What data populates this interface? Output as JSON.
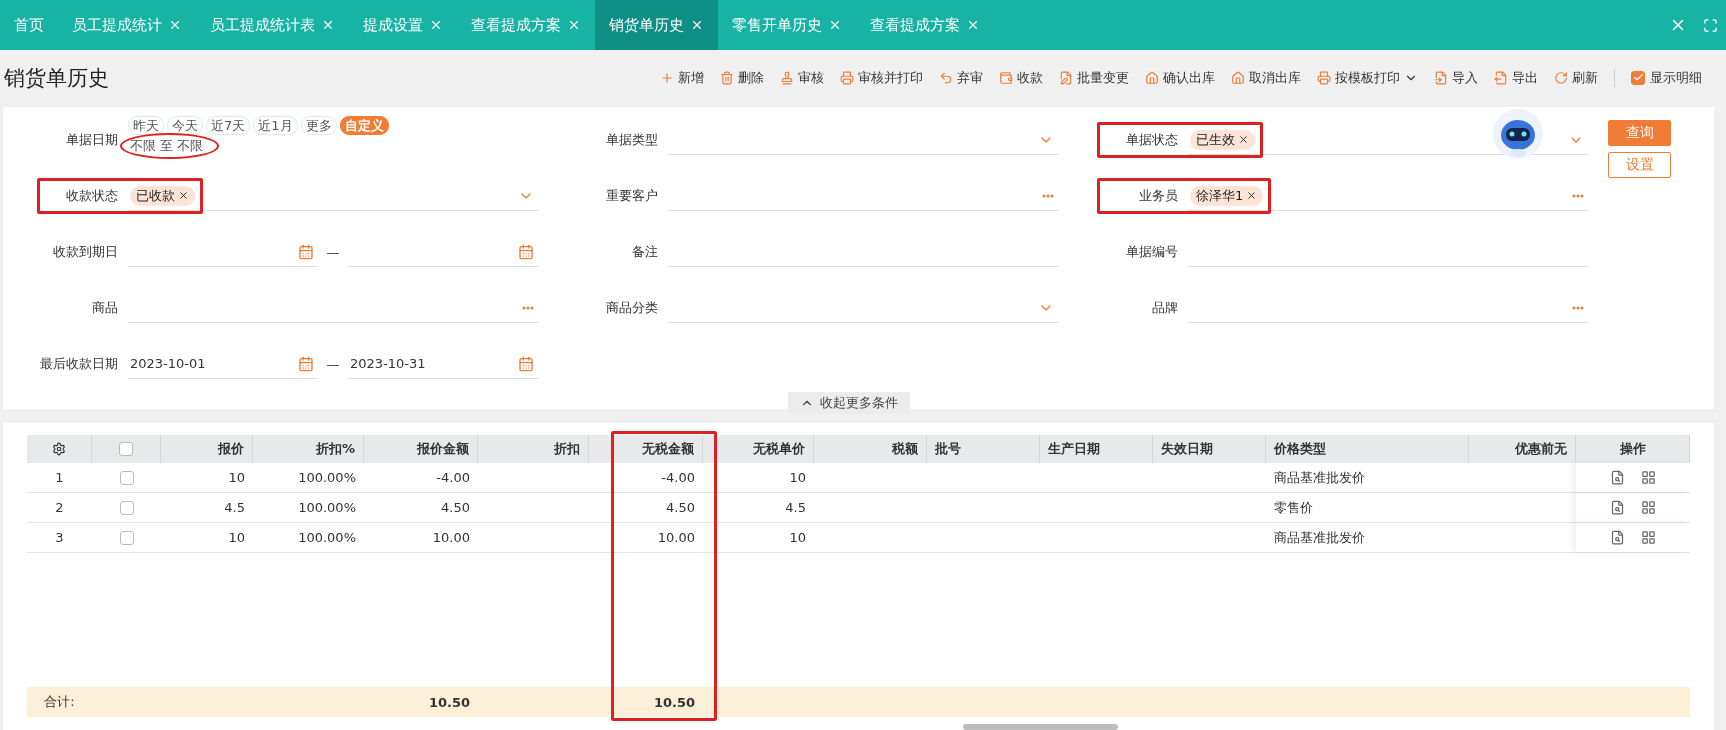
{
  "tabs": [
    {
      "label": "首页",
      "closable": false,
      "selected": false
    },
    {
      "label": "员工提成统计",
      "closable": true,
      "selected": false
    },
    {
      "label": "员工提成统计表",
      "closable": true,
      "selected": false
    },
    {
      "label": "提成设置",
      "closable": true,
      "selected": false
    },
    {
      "label": "查看提成方案",
      "closable": true,
      "selected": false
    },
    {
      "label": "销货单历史",
      "closable": true,
      "selected": true
    },
    {
      "label": "零售开单历史",
      "closable": true,
      "selected": false
    },
    {
      "label": "查看提成方案",
      "closable": true,
      "selected": false
    }
  ],
  "page_title": "销货单历史",
  "toolbar": {
    "actions": [
      {
        "label": "新增"
      },
      {
        "label": "删除"
      },
      {
        "label": "审核"
      },
      {
        "label": "审核并打印"
      },
      {
        "label": "弃审"
      },
      {
        "label": "收款"
      },
      {
        "label": "批量变更"
      },
      {
        "label": "确认出库"
      },
      {
        "label": "取消出库"
      },
      {
        "label": "按模板打印",
        "dropdown": true
      },
      {
        "label": "导入"
      },
      {
        "label": "导出"
      },
      {
        "label": "刷新"
      }
    ],
    "show_detail": {
      "label": "显示明细",
      "checked": true
    }
  },
  "filters": {
    "rows": [
      {
        "fields": [
          {
            "kind": "quick_dates",
            "label": "单据日期",
            "chips": [
              {
                "label": "昨天",
                "selected": false
              },
              {
                "label": "今天",
                "selected": false
              },
              {
                "label": "近7天",
                "selected": false
              },
              {
                "label": "近1月",
                "selected": false
              },
              {
                "label": "更多",
                "selected": false
              },
              {
                "label": "自定义",
                "selected": true
              }
            ],
            "range": {
              "text": "不限 至 不限",
              "circled": true
            }
          },
          {
            "kind": "select",
            "label": "单据类型"
          },
          {
            "kind": "select",
            "label": "单据状态",
            "tags": [
              "已生效"
            ],
            "boxed": true
          }
        ]
      },
      {
        "fields": [
          {
            "kind": "select",
            "label": "收款状态",
            "tags": [
              "已收款"
            ],
            "boxed": true
          },
          {
            "kind": "lookup",
            "label": "重要客户"
          },
          {
            "kind": "lookup",
            "label": "业务员",
            "tags": [
              "徐泽华1"
            ],
            "boxed": true
          }
        ]
      },
      {
        "fields": [
          {
            "kind": "daterange",
            "label": "收款到期日",
            "separator": "—"
          },
          {
            "kind": "text",
            "label": "备注"
          },
          {
            "kind": "text",
            "label": "单据编号"
          }
        ]
      },
      {
        "fields": [
          {
            "kind": "lookup",
            "label": "商品"
          },
          {
            "kind": "select",
            "label": "商品分类"
          },
          {
            "kind": "lookup",
            "label": "品牌"
          }
        ]
      },
      {
        "fields": [
          {
            "kind": "daterange",
            "label": "最后收款日期",
            "from": "2023-10-01",
            "to": "2023-10-31",
            "separator": "—"
          }
        ]
      }
    ],
    "buttons": [
      {
        "label": "查询",
        "kind": "primary"
      },
      {
        "label": "设置",
        "kind": "secondary"
      }
    ],
    "collapse": {
      "label": "收起更多条件"
    }
  },
  "table": {
    "header_checked": false,
    "columns": [
      {
        "label": "报价",
        "kind": "number"
      },
      {
        "label": "折扣%",
        "kind": "number"
      },
      {
        "label": "报价金额",
        "kind": "number"
      },
      {
        "label": "折扣",
        "kind": "number"
      },
      {
        "label": "无税金额",
        "kind": "number",
        "boxed": true
      },
      {
        "label": "无税单价",
        "kind": "number"
      },
      {
        "label": "税额",
        "kind": "number"
      },
      {
        "label": "批号",
        "kind": "text"
      },
      {
        "label": "生产日期",
        "kind": "text"
      },
      {
        "label": "失效日期",
        "kind": "text"
      },
      {
        "label": "价格类型",
        "kind": "text"
      },
      {
        "label": "优惠前无",
        "kind": "number"
      }
    ],
    "action_column": "操作",
    "rows": [
      {
        "index": "1",
        "checked": false,
        "cells": [
          "10",
          "100.00%",
          "-4.00",
          null,
          "-4.00",
          "10",
          null,
          null,
          null,
          null,
          "商品基准批发价",
          null
        ]
      },
      {
        "index": "2",
        "checked": false,
        "cells": [
          "4.5",
          "100.00%",
          "4.50",
          null,
          "4.50",
          "4.5",
          null,
          null,
          null,
          null,
          "零售价",
          null
        ]
      },
      {
        "index": "3",
        "checked": false,
        "cells": [
          "10",
          "100.00%",
          "10.00",
          null,
          "10.00",
          "10",
          null,
          null,
          null,
          null,
          "商品基准批发价",
          null
        ]
      }
    ],
    "summary": {
      "label": "合计:",
      "cells": [
        null,
        null,
        "10.50",
        null,
        "10.50",
        null,
        null,
        null,
        null,
        null,
        null,
        null
      ]
    }
  }
}
